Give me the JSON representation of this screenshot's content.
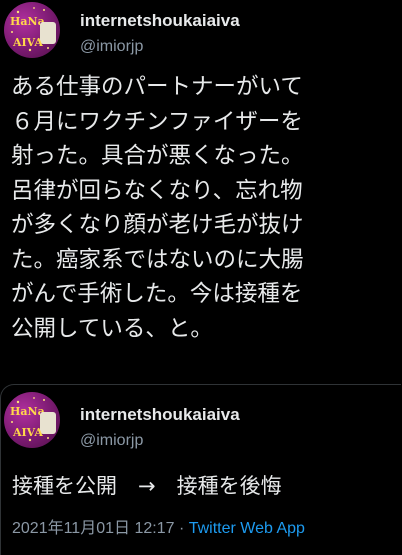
{
  "main_tweet": {
    "avatar": {
      "line1": "HaNa",
      "line2": "AIVA"
    },
    "display_name": "internetshoukaiaiva",
    "handle": "@imiorjp",
    "text_lines": [
      "ある仕事のパートナーがいて",
      "６月にワクチンファイザーを",
      "射った。具合が悪くなった。",
      "呂律が回らなくなり、忘れ物",
      "が多くなり顔が老け毛が抜け",
      "た。癌家系ではないのに大腸",
      "がんで手術した。今は接種を",
      "公開している、と。"
    ]
  },
  "quoted_tweet": {
    "avatar": {
      "line1": "HaNa",
      "line2": "AIVA"
    },
    "display_name": "internetshoukaiaiva",
    "handle": "@imiorjp",
    "text": "接種を公開　→　接種を後悔",
    "timestamp": "2021年11月01日 12:17",
    "separator": " · ",
    "source": "Twitter Web App"
  },
  "colors": {
    "background": "#000000",
    "text": "#e7e9ea",
    "secondary": "#8b98a5",
    "link": "#1d9bf0",
    "border": "#2f3336"
  }
}
